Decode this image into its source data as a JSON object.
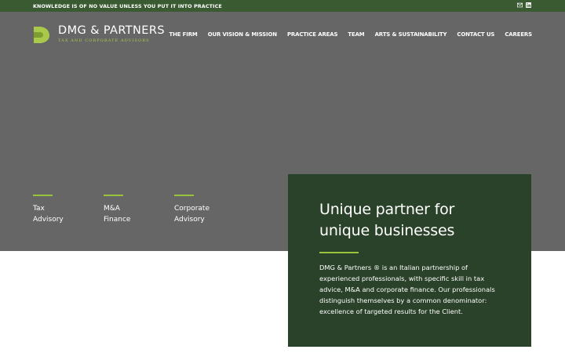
{
  "topbar": {
    "tagline": "KNOWLEDGE IS OF NO VALUE UNLESS YOU PUT IT INTO PRACTICE",
    "icons": [
      "mail-icon",
      "linkedin-icon"
    ]
  },
  "logo": {
    "name": "DMG & PARTNERS",
    "subtitle": "TAX AND CORPORATE ADVISORS"
  },
  "nav": {
    "items": [
      {
        "label": "THE FIRM"
      },
      {
        "label": "OUR VISION & MISSION"
      },
      {
        "label": "PRACTICE AREAS"
      },
      {
        "label": "TEAM"
      },
      {
        "label": "ARTS & SUSTAINABILITY"
      },
      {
        "label": "CONTACT US"
      },
      {
        "label": "CAREERS"
      }
    ]
  },
  "services": [
    {
      "label": "Tax Advisory"
    },
    {
      "label": "M&A Finance"
    },
    {
      "label": "Corporate Advisory"
    }
  ],
  "panel": {
    "title": "Unique partner for unique businesses",
    "body": "DMG & Partners ® is an Italian partnership of experienced professionals, with specific skill in tax advice, M&A and corporate finance. Our professionals distinguish themselves by a common denominator: excellence of targeted results for the Client."
  },
  "colors": {
    "topbar": "#3a5a32",
    "hero": "#666666",
    "panel": "#2a4229",
    "accent": "#9ac33c"
  }
}
